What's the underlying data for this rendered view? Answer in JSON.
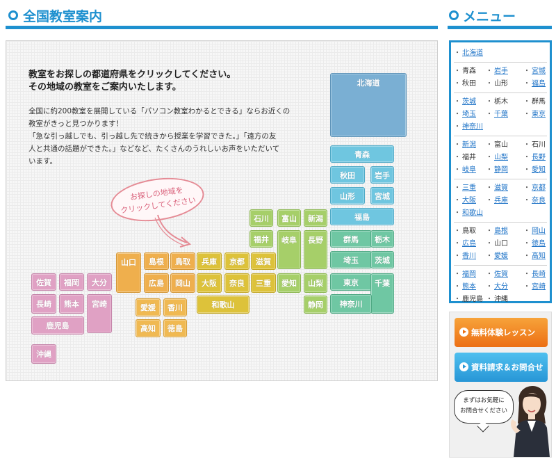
{
  "main": {
    "title": "全国教室案内",
    "lead_line1": "教室をお探しの都道府県をクリックしてください。",
    "lead_line2": "その地域の教室をご案内いたします。",
    "desc_line1": "全国に約200教室を展開している「パソコン教室わかるとできる」ならお近くの",
    "desc_line2": "教室がきっと見つかります！",
    "desc_line3": "「急な引っ越しでも、引っ越し先で続きから授業を学習できた。」「遠方の友",
    "desc_line4": "人と共通の話題ができた。」などなど、たくさんのうれしいお声をいただいて",
    "desc_line5": "います。",
    "bubble_line1": "お探しの地域を",
    "bubble_line2": "クリックしてください"
  },
  "prefectures": [
    {
      "id": "hokkaido",
      "label": "北海道",
      "region": "hok"
    },
    {
      "id": "aomori",
      "label": "青森",
      "region": "toh"
    },
    {
      "id": "akita",
      "label": "秋田",
      "region": "toh"
    },
    {
      "id": "iwate",
      "label": "岩手",
      "region": "toh"
    },
    {
      "id": "yamagata",
      "label": "山形",
      "region": "toh"
    },
    {
      "id": "miyagi",
      "label": "宮城",
      "region": "toh"
    },
    {
      "id": "fukushima",
      "label": "福島",
      "region": "toh"
    },
    {
      "id": "gunma",
      "label": "群馬",
      "region": "kan"
    },
    {
      "id": "tochigi",
      "label": "栃木",
      "region": "kan"
    },
    {
      "id": "saitama",
      "label": "埼玉",
      "region": "kan"
    },
    {
      "id": "ibaraki",
      "label": "茨城",
      "region": "kan"
    },
    {
      "id": "tokyo",
      "label": "東京",
      "region": "kan"
    },
    {
      "id": "chiba",
      "label": "千葉",
      "region": "kan"
    },
    {
      "id": "kanagawa",
      "label": "神奈川",
      "region": "kan"
    },
    {
      "id": "ishikawa",
      "label": "石川",
      "region": "chu"
    },
    {
      "id": "toyama",
      "label": "富山",
      "region": "chu"
    },
    {
      "id": "niigata",
      "label": "新潟",
      "region": "chu"
    },
    {
      "id": "fukui",
      "label": "福井",
      "region": "chu"
    },
    {
      "id": "gifu",
      "label": "岐阜",
      "region": "chu"
    },
    {
      "id": "nagano",
      "label": "長野",
      "region": "chu"
    },
    {
      "id": "aichi",
      "label": "愛知",
      "region": "chu"
    },
    {
      "id": "yamanashi",
      "label": "山梨",
      "region": "chu"
    },
    {
      "id": "shizuoka",
      "label": "静岡",
      "region": "chu"
    },
    {
      "id": "hyogo",
      "label": "兵庫",
      "region": "kin"
    },
    {
      "id": "kyoto",
      "label": "京都",
      "region": "kin"
    },
    {
      "id": "shiga",
      "label": "滋賀",
      "region": "kin"
    },
    {
      "id": "osaka",
      "label": "大阪",
      "region": "kin"
    },
    {
      "id": "nara",
      "label": "奈良",
      "region": "kin"
    },
    {
      "id": "mie",
      "label": "三重",
      "region": "kin"
    },
    {
      "id": "wakayama",
      "label": "和歌山",
      "region": "kin"
    },
    {
      "id": "yamaguchi",
      "label": "山口",
      "region": "chg"
    },
    {
      "id": "shimane",
      "label": "島根",
      "region": "chg"
    },
    {
      "id": "tottori",
      "label": "鳥取",
      "region": "chg"
    },
    {
      "id": "hiroshima",
      "label": "広島",
      "region": "chg"
    },
    {
      "id": "okayama",
      "label": "岡山",
      "region": "chg"
    },
    {
      "id": "ehime",
      "label": "愛媛",
      "region": "shi"
    },
    {
      "id": "kagawa",
      "label": "香川",
      "region": "shi"
    },
    {
      "id": "kochi",
      "label": "高知",
      "region": "shi"
    },
    {
      "id": "tokushima",
      "label": "徳島",
      "region": "shi"
    },
    {
      "id": "saga",
      "label": "佐賀",
      "region": "kyu"
    },
    {
      "id": "fukuoka",
      "label": "福岡",
      "region": "kyu"
    },
    {
      "id": "oita",
      "label": "大分",
      "region": "kyu"
    },
    {
      "id": "nagasaki",
      "label": "長崎",
      "region": "kyu"
    },
    {
      "id": "kumamoto",
      "label": "熊本",
      "region": "kyu"
    },
    {
      "id": "miyazaki",
      "label": "宮崎",
      "region": "kyu"
    },
    {
      "id": "kagoshima",
      "label": "鹿児島",
      "region": "kyu"
    },
    {
      "id": "okinawa",
      "label": "沖縄",
      "region": "kyu"
    }
  ],
  "region_colors": {
    "hok": "#7aafd3",
    "toh": "#6fc6e0",
    "kan": "#6fc7a3",
    "chu": "#a6cf69",
    "kin": "#ddc23a",
    "chg": "#efaf4d",
    "shi": "#f0b952",
    "kyu": "#e0a1c4"
  },
  "menu": {
    "title": "メニュー",
    "groups": [
      {
        "items": [
          {
            "label": "北海道",
            "link": true
          }
        ]
      },
      {
        "items": [
          {
            "label": "青森",
            "link": false
          },
          {
            "label": "岩手",
            "link": true
          },
          {
            "label": "宮城",
            "link": true
          },
          {
            "label": "秋田",
            "link": false
          },
          {
            "label": "山形",
            "link": false
          },
          {
            "label": "福島",
            "link": true
          }
        ]
      },
      {
        "items": [
          {
            "label": "茨城",
            "link": true
          },
          {
            "label": "栃木",
            "link": false
          },
          {
            "label": "群馬",
            "link": false
          },
          {
            "label": "埼玉",
            "link": true
          },
          {
            "label": "千葉",
            "link": true
          },
          {
            "label": "東京",
            "link": true
          },
          {
            "label": "神奈川",
            "link": true
          }
        ]
      },
      {
        "items": [
          {
            "label": "新潟",
            "link": true
          },
          {
            "label": "富山",
            "link": false
          },
          {
            "label": "石川",
            "link": false
          },
          {
            "label": "福井",
            "link": false
          },
          {
            "label": "山梨",
            "link": true
          },
          {
            "label": "長野",
            "link": true
          },
          {
            "label": "岐阜",
            "link": true
          },
          {
            "label": "静岡",
            "link": true
          },
          {
            "label": "愛知",
            "link": true
          }
        ]
      },
      {
        "items": [
          {
            "label": "三重",
            "link": true
          },
          {
            "label": "滋賀",
            "link": true
          },
          {
            "label": "京都",
            "link": true
          },
          {
            "label": "大阪",
            "link": true
          },
          {
            "label": "兵庫",
            "link": true
          },
          {
            "label": "奈良",
            "link": true
          },
          {
            "label": "和歌山",
            "link": true
          }
        ]
      },
      {
        "items": [
          {
            "label": "鳥取",
            "link": false
          },
          {
            "label": "島根",
            "link": true
          },
          {
            "label": "岡山",
            "link": true
          },
          {
            "label": "広島",
            "link": true
          },
          {
            "label": "山口",
            "link": false
          },
          {
            "label": "徳島",
            "link": true
          },
          {
            "label": "香川",
            "link": true
          },
          {
            "label": "愛媛",
            "link": true
          },
          {
            "label": "高知",
            "link": true
          }
        ]
      },
      {
        "items": [
          {
            "label": "福岡",
            "link": true
          },
          {
            "label": "佐賀",
            "link": true
          },
          {
            "label": "長崎",
            "link": true
          },
          {
            "label": "熊本",
            "link": true
          },
          {
            "label": "大分",
            "link": true
          },
          {
            "label": "宮崎",
            "link": true
          },
          {
            "label": "鹿児島",
            "link": false
          },
          {
            "label": "沖縄",
            "link": false
          }
        ]
      }
    ]
  },
  "side": {
    "trial_button": "無料体験レッスン",
    "contact_button": "資料請求＆お問合せ",
    "speech_line1": "まずはお気軽に",
    "speech_line2": "お問合せください"
  }
}
